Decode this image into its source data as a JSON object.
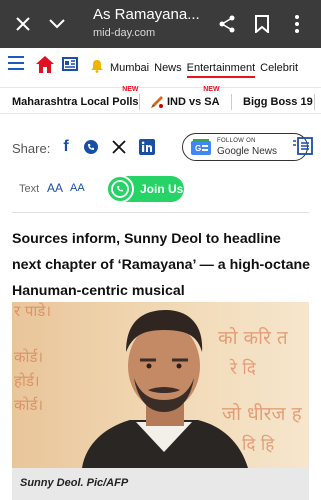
{
  "browser": {
    "title": "As Ramayana...",
    "url": "mid-day.com",
    "icons": [
      "close-icon",
      "chevron-down-icon",
      "share-icon",
      "bookmark-icon",
      "more-icon"
    ]
  },
  "nav": {
    "links": [
      "Mumbai",
      "News",
      "Entertainment",
      "Celebrit"
    ],
    "active": "Entertainment"
  },
  "trending": [
    {
      "label": "Maharashtra Local Polls",
      "badge": "NEW"
    },
    {
      "label": "IND vs SA",
      "badge": "NEW"
    },
    {
      "label": "Bigg Boss 19",
      "badge": ""
    }
  ],
  "share": {
    "label": "Share:",
    "google_follow": "FOLLOW ON",
    "google_news": "Google News"
  },
  "font_controls": {
    "text_label": "Text",
    "increase": "AA",
    "decrease": "AA",
    "join_label": "Join Us"
  },
  "article": {
    "headline": "Sources inform, Sunny Deol to headline next chapter of ‘Ramayana’ — a high-octane Hanuman-centric musical",
    "caption": "Sunny Deol. Pic/AFP"
  },
  "colors": {
    "toolbar": "#3b3b3b",
    "brand_blue": "#1a4fa6",
    "accent_red": "#e11122",
    "whatsapp": "#25d366"
  }
}
